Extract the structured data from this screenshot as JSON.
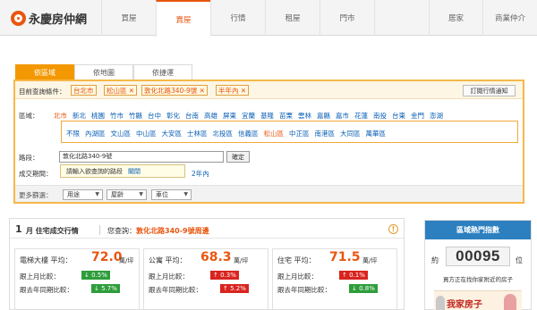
{
  "brand": {
    "name": "永慶房仲網",
    "accent": "#e8560f"
  },
  "nav": {
    "tabs": [
      "買屋",
      "賣屋",
      "行情",
      "租屋",
      "門市",
      "居家",
      "商業仲介"
    ],
    "active": "賣屋"
  },
  "search_tabs": {
    "items": [
      "依區域",
      "依地圖",
      "依捷運"
    ],
    "active": "依區域"
  },
  "current_query": {
    "label": "目前查詢條件：",
    "chips": [
      "台北市",
      "松山區 ✕",
      "敦化北路340-9號 ✕",
      "半年內 ✕"
    ],
    "subscribe_button": "訂閱行情通知"
  },
  "region": {
    "label": "區域：",
    "cities": [
      "北市",
      "新北",
      "桃園",
      "竹市",
      "竹縣",
      "台中",
      "彰化",
      "台南",
      "高雄",
      "屏東",
      "宜蘭",
      "基隆",
      "苗栗",
      "雲林",
      "嘉縣",
      "嘉市",
      "花蓮",
      "南投",
      "台東",
      "金門",
      "澎湖"
    ],
    "selected_city": "北市",
    "districts": [
      "不限",
      "內湖區",
      "文山區",
      "中山區",
      "大安區",
      "士林區",
      "北投區",
      "信義區",
      "松山區",
      "中正區",
      "南港區",
      "大同區",
      "萬華區"
    ],
    "selected_district": "松山區"
  },
  "road": {
    "label": "路段：",
    "value": "敦化北路340-9號",
    "set_button": "確定"
  },
  "deal_period": {
    "label": "成交期間：",
    "hint": "請輸入欲查詢的路段",
    "close": "關閉",
    "visible_option": "2年內"
  },
  "more_filters": {
    "label": "更多篩選：",
    "selects": [
      "用途",
      "屋齡",
      "車位"
    ]
  },
  "market": {
    "month": "1",
    "title": "月 住宅成交行情",
    "query_label": "您查詢：",
    "query_addr": "敦化北路340-9號周邊",
    "avg_label": "平均：",
    "unit": "萬/坪",
    "mom_label": "跟上月比較：",
    "yoy_label": "跟去年同期比較：",
    "cards": [
      {
        "name": "電梯大樓",
        "price": "72.0",
        "mom": "↓ 0.5%",
        "mom_dir": "down",
        "yoy": "↓ 5.7%",
        "yoy_dir": "down"
      },
      {
        "name": "公寓",
        "price": "68.3",
        "mom": "↑ 0.3%",
        "mom_dir": "up",
        "yoy": "↑ 5.2%",
        "yoy_dir": "up"
      },
      {
        "name": "住宅",
        "price": "71.5",
        "mom": "↑ 0.1%",
        "mom_dir": "up",
        "yoy": "↓ 0.8%",
        "yoy_dir": "down"
      }
    ]
  },
  "side": {
    "title": "區域熱門指數",
    "approx": "約",
    "count": "00095",
    "unit": "位",
    "text": "買方正在找你家附近的房子",
    "ad_text": "我家房子"
  }
}
